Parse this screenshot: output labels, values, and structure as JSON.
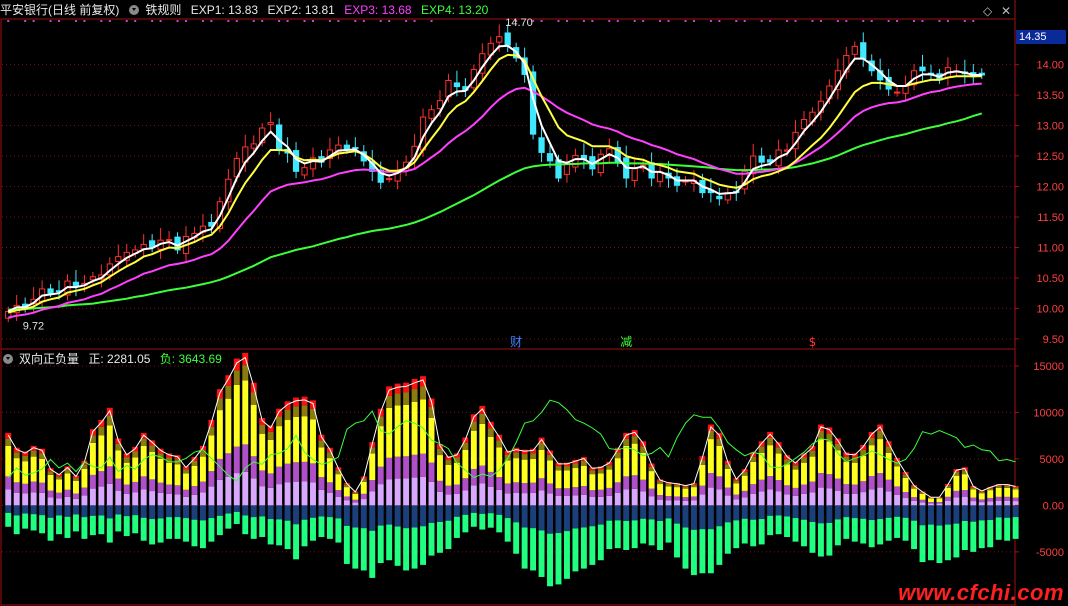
{
  "header_top": {
    "title": "平安银行(日线 前复权)",
    "indicator": "铁规则",
    "exp1_label": "EXP1:",
    "exp1_value": "13.83",
    "exp2_label": "EXP2:",
    "exp2_value": "13.81",
    "exp3_label": "EXP3:",
    "exp3_value": "13.68",
    "exp4_label": "EXP4:",
    "exp4_value": "13.20",
    "colors": {
      "exp1": "#e8e8e8",
      "exp2": "#e8e8e8",
      "exp3": "#ff40ff",
      "exp4": "#3cff3c"
    }
  },
  "header_bottom": {
    "indicator": "双向正负量",
    "pos_label": "正:",
    "pos_value": "2281.05",
    "neg_label": "负:",
    "neg_value": "3643.69"
  },
  "current_price_tag": "14.35",
  "event_markers": [
    {
      "label": "财",
      "index": 60,
      "color": "#4080ff"
    },
    {
      "label": "减",
      "index": 73,
      "color": "#3cff3c"
    },
    {
      "label": "$",
      "index": 95,
      "color": "#ff3030"
    }
  ],
  "watermark": "www.cfchi.com",
  "chart_data": [
    {
      "type": "candlestick",
      "title": "平安银行(日线 前复权)",
      "y_ticks": [
        "14.00",
        "13.50",
        "13.00",
        "12.50",
        "12.00",
        "11.50",
        "11.00",
        "10.50",
        "10.00",
        "9.50"
      ],
      "ylim": [
        9.4,
        14.7
      ],
      "grid": true,
      "annotations": [
        {
          "text": "14.70",
          "index": 58,
          "value": 14.7
        },
        {
          "text": "9.72",
          "index": 1,
          "value": 9.72
        }
      ],
      "colors": {
        "up": "#ff3030",
        "down": "#40e8ff",
        "exp1": "#ffffff",
        "exp2": "#ffff40",
        "exp3": "#ff40ff",
        "exp4": "#3cff3c"
      },
      "closes": [
        9.95,
        10.05,
        10.02,
        10.15,
        10.32,
        10.25,
        10.28,
        10.45,
        10.36,
        10.41,
        10.52,
        10.55,
        10.73,
        10.85,
        10.92,
        10.96,
        11.05,
        11.01,
        11.12,
        11.13,
        10.96,
        11.18,
        11.23,
        11.35,
        11.35,
        11.75,
        12.12,
        12.46,
        12.65,
        12.7,
        12.96,
        13.05,
        12.61,
        12.55,
        12.25,
        12.31,
        12.47,
        12.4,
        12.6,
        12.68,
        12.6,
        12.63,
        12.42,
        12.25,
        12.07,
        12.13,
        12.26,
        12.4,
        12.66,
        13.14,
        13.26,
        13.41,
        13.74,
        13.64,
        13.58,
        13.92,
        14.18,
        14.35,
        14.46,
        14.32,
        14.11,
        13.84,
        12.86,
        12.56,
        12.42,
        12.14,
        12.36,
        12.51,
        12.45,
        12.29,
        12.53,
        12.62,
        12.41,
        12.14,
        12.3,
        12.35,
        12.14,
        12.24,
        12.14,
        12.02,
        12.09,
        12.1,
        11.9,
        11.9,
        11.8,
        11.9,
        11.9,
        12.25,
        12.5,
        12.4,
        12.4,
        12.6,
        12.6,
        12.89,
        13.1,
        13.22,
        13.4,
        13.65,
        13.9,
        14.15,
        14.3,
        14.1,
        13.9,
        13.75,
        13.6,
        13.55,
        13.65,
        13.9,
        13.9,
        13.85,
        13.75,
        13.95,
        13.9,
        13.85,
        13.8,
        13.83
      ],
      "exp1": [
        9.95,
        10.02,
        10.02,
        10.09,
        10.21,
        10.23,
        10.25,
        10.35,
        10.35,
        10.38,
        10.45,
        10.5,
        10.62,
        10.73,
        10.83,
        10.9,
        10.97,
        10.99,
        11.06,
        11.09,
        11.03,
        11.1,
        11.17,
        11.26,
        11.3,
        11.52,
        11.82,
        12.14,
        12.4,
        12.55,
        12.75,
        12.9,
        12.76,
        12.65,
        12.45,
        12.38,
        12.42,
        12.41,
        12.5,
        12.59,
        12.6,
        12.61,
        12.52,
        12.38,
        12.22,
        12.18,
        12.22,
        12.31,
        12.48,
        12.81,
        13.04,
        13.22,
        13.48,
        13.56,
        13.57,
        13.74,
        13.96,
        14.15,
        14.3,
        14.31,
        14.21,
        14.02,
        13.44,
        13.0,
        12.71,
        12.42,
        12.39,
        12.45,
        12.45,
        12.37,
        12.45,
        12.53,
        12.47,
        12.31,
        12.3,
        12.33,
        12.24,
        12.24,
        12.19,
        12.1,
        12.1,
        12.1,
        12.0,
        11.95,
        11.88,
        11.89,
        11.9,
        12.07,
        12.29,
        12.34,
        12.37,
        12.48,
        12.54,
        12.71,
        12.91,
        13.06,
        13.23,
        13.44,
        13.67,
        13.91,
        14.1,
        14.1,
        14.0,
        13.88,
        13.74,
        13.65,
        13.65,
        13.77,
        13.84,
        13.84,
        13.8,
        13.87,
        13.89,
        13.87,
        13.83,
        13.83
      ],
      "exp2": [
        9.93,
        9.97,
        9.99,
        10.03,
        10.11,
        10.15,
        10.18,
        10.26,
        10.29,
        10.32,
        10.38,
        10.43,
        10.52,
        10.61,
        10.69,
        10.76,
        10.85,
        10.89,
        10.95,
        11.0,
        10.99,
        11.04,
        11.09,
        11.16,
        11.21,
        11.35,
        11.56,
        11.82,
        12.06,
        12.24,
        12.44,
        12.6,
        12.6,
        12.59,
        12.48,
        12.43,
        12.44,
        12.43,
        12.48,
        12.54,
        12.56,
        12.58,
        12.53,
        12.44,
        12.32,
        12.26,
        12.26,
        12.3,
        12.4,
        12.6,
        12.79,
        12.97,
        13.18,
        13.32,
        13.4,
        13.55,
        13.73,
        13.92,
        14.09,
        14.16,
        14.15,
        14.07,
        13.77,
        13.48,
        13.23,
        12.97,
        12.84,
        12.79,
        12.74,
        12.66,
        12.66,
        12.66,
        12.6,
        12.5,
        12.46,
        12.44,
        12.38,
        12.35,
        12.31,
        12.25,
        12.23,
        12.21,
        12.14,
        12.09,
        12.03,
        12.0,
        11.98,
        12.03,
        12.12,
        12.17,
        12.2,
        12.25,
        12.31,
        12.42,
        12.55,
        12.68,
        12.8,
        12.96,
        13.15,
        13.35,
        13.55,
        13.65,
        13.7,
        13.7,
        13.68,
        13.65,
        13.65,
        13.69,
        13.72,
        13.75,
        13.75,
        13.79,
        13.81,
        13.81,
        13.81,
        13.81
      ],
      "exp3": [
        9.85,
        9.88,
        9.9,
        9.93,
        9.98,
        10.01,
        10.04,
        10.09,
        10.12,
        10.15,
        10.2,
        10.24,
        10.31,
        10.37,
        10.44,
        10.5,
        10.57,
        10.61,
        10.66,
        10.71,
        10.73,
        10.76,
        10.8,
        10.85,
        10.89,
        10.98,
        11.11,
        11.28,
        11.45,
        11.6,
        11.77,
        11.92,
        11.98,
        12.03,
        12.05,
        12.07,
        12.1,
        12.12,
        12.16,
        12.21,
        12.24,
        12.27,
        12.28,
        12.27,
        12.25,
        12.24,
        12.24,
        12.25,
        12.29,
        12.38,
        12.48,
        12.58,
        12.71,
        12.82,
        12.91,
        13.02,
        13.15,
        13.3,
        13.43,
        13.53,
        13.6,
        13.62,
        13.56,
        13.48,
        13.39,
        13.29,
        13.21,
        13.15,
        13.09,
        13.02,
        12.98,
        12.95,
        12.9,
        12.83,
        12.78,
        12.74,
        12.68,
        12.64,
        12.59,
        12.53,
        12.49,
        12.45,
        12.39,
        12.34,
        12.29,
        12.25,
        12.21,
        12.21,
        12.23,
        12.24,
        12.26,
        12.29,
        12.32,
        12.39,
        12.47,
        12.56,
        12.65,
        12.76,
        12.88,
        13.01,
        13.15,
        13.24,
        13.3,
        13.34,
        13.37,
        13.38,
        13.41,
        13.46,
        13.51,
        13.55,
        13.57,
        13.61,
        13.64,
        13.66,
        13.68,
        13.69
      ],
      "exp4": [
        9.98,
        9.99,
        9.99,
        10.0,
        10.01,
        10.02,
        10.03,
        10.05,
        10.06,
        10.07,
        10.08,
        10.1,
        10.12,
        10.14,
        10.16,
        10.19,
        10.21,
        10.24,
        10.27,
        10.3,
        10.32,
        10.34,
        10.37,
        10.4,
        10.43,
        10.47,
        10.52,
        10.58,
        10.64,
        10.7,
        10.77,
        10.84,
        10.88,
        10.92,
        10.96,
        10.99,
        11.02,
        11.06,
        11.1,
        11.14,
        11.17,
        11.21,
        11.24,
        11.27,
        11.29,
        11.31,
        11.34,
        11.37,
        11.41,
        11.46,
        11.52,
        11.58,
        11.65,
        11.72,
        11.79,
        11.86,
        11.94,
        12.02,
        12.1,
        12.17,
        12.24,
        12.3,
        12.33,
        12.35,
        12.36,
        12.36,
        12.37,
        12.37,
        12.38,
        12.38,
        12.38,
        12.39,
        12.39,
        12.38,
        12.38,
        12.38,
        12.37,
        12.37,
        12.36,
        12.35,
        12.34,
        12.33,
        12.32,
        12.31,
        12.29,
        12.28,
        12.27,
        12.27,
        12.27,
        12.28,
        12.28,
        12.29,
        12.3,
        12.32,
        12.35,
        12.38,
        12.42,
        12.46,
        12.51,
        12.57,
        12.63,
        12.68,
        12.72,
        12.76,
        12.8,
        12.83,
        12.86,
        12.9,
        12.94,
        12.97,
        13.0,
        13.04,
        13.07,
        13.11,
        13.16,
        13.2
      ]
    },
    {
      "type": "bar",
      "title": "双向正负量",
      "series": [
        {
          "name": "正",
          "values": [
            7800,
            6200,
            5800,
            6400,
            6100,
            4000,
            3400,
            4200,
            3200,
            4800,
            8200,
            9200,
            10500,
            7200,
            5600,
            6300,
            7800,
            7000,
            6100,
            5600,
            5400,
            4200,
            5200,
            6400,
            9200,
            12500,
            14000,
            15800,
            16400,
            13200,
            9400,
            8600,
            10400,
            11200,
            11600,
            11700,
            11300,
            7600,
            6200,
            4100,
            2400,
            1500,
            3100,
            6800,
            10400,
            12800,
            13100,
            13200,
            13600,
            13900,
            11500,
            6600,
            5300,
            5600,
            7300,
            9800,
            10700,
            9000,
            7600,
            5900,
            6200,
            6000,
            6100,
            7300,
            5900,
            4600,
            4600,
            4900,
            5200,
            4100,
            4200,
            4700,
            6200,
            7800,
            8100,
            6900,
            4500,
            2800,
            2500,
            2400,
            2200,
            2400,
            5300,
            8700,
            7800,
            4800,
            2900,
            3900,
            5700,
            6900,
            7900,
            6800,
            5400,
            4700,
            5600,
            6400,
            8700,
            8400,
            7200,
            5700,
            5600,
            6500,
            7900,
            8700,
            6900,
            5100,
            3600,
            2200,
            1500,
            900,
            900,
            2300,
            3900,
            4100,
            2100,
            1600,
            2000,
            2300,
            2300,
            2100
          ]
        },
        {
          "name": "负",
          "values": [
            -2300,
            -3100,
            -2500,
            -2700,
            -3000,
            -3800,
            -3100,
            -3500,
            -2800,
            -3600,
            -3200,
            -3100,
            -4000,
            -2800,
            -3300,
            -3000,
            -3800,
            -4200,
            -4000,
            -3600,
            -3600,
            -3900,
            -4400,
            -4600,
            -3900,
            -3200,
            -2500,
            -2000,
            -3100,
            -3600,
            -3400,
            -4200,
            -4300,
            -4700,
            -5800,
            -4400,
            -3800,
            -3400,
            -3600,
            -4000,
            -6300,
            -6800,
            -7000,
            -7800,
            -6200,
            -5900,
            -6500,
            -7000,
            -6800,
            -6400,
            -5400,
            -5100,
            -4700,
            -3500,
            -2900,
            -2300,
            -2600,
            -2400,
            -2900,
            -3900,
            -5200,
            -6800,
            -7000,
            -7700,
            -8700,
            -8500,
            -7900,
            -7100,
            -6800,
            -6400,
            -5900,
            -4700,
            -4600,
            -4800,
            -4600,
            -4100,
            -4300,
            -4800,
            -4000,
            -5600,
            -6800,
            -7500,
            -7300,
            -7300,
            -6400,
            -5200,
            -4600,
            -4100,
            -4400,
            -4200,
            -3200,
            -3100,
            -3400,
            -3900,
            -4400,
            -5100,
            -5500,
            -5400,
            -4300,
            -3600,
            -3900,
            -4100,
            -4500,
            -4200,
            -3800,
            -3500,
            -3800,
            -4700,
            -6100,
            -5900,
            -6200,
            -5900,
            -5600,
            -4800,
            -5000,
            -4600,
            -4500,
            -3700,
            -3800,
            -3600
          ]
        }
      ],
      "y_ticks": [
        "15000",
        "10000",
        "5000",
        "0.00",
        "-5000"
      ],
      "ylim": [
        -10500,
        16500
      ],
      "colors": {
        "pos_layers": [
          "#d8a8ff",
          "#b050c8",
          "#ffff20",
          "#8a7a10",
          "#ff1010"
        ],
        "neg_top": "#1a3f7a",
        "neg_bottom": "#20ff80",
        "white_line": "#ffffff",
        "green_line": "#3cff3c"
      }
    }
  ]
}
